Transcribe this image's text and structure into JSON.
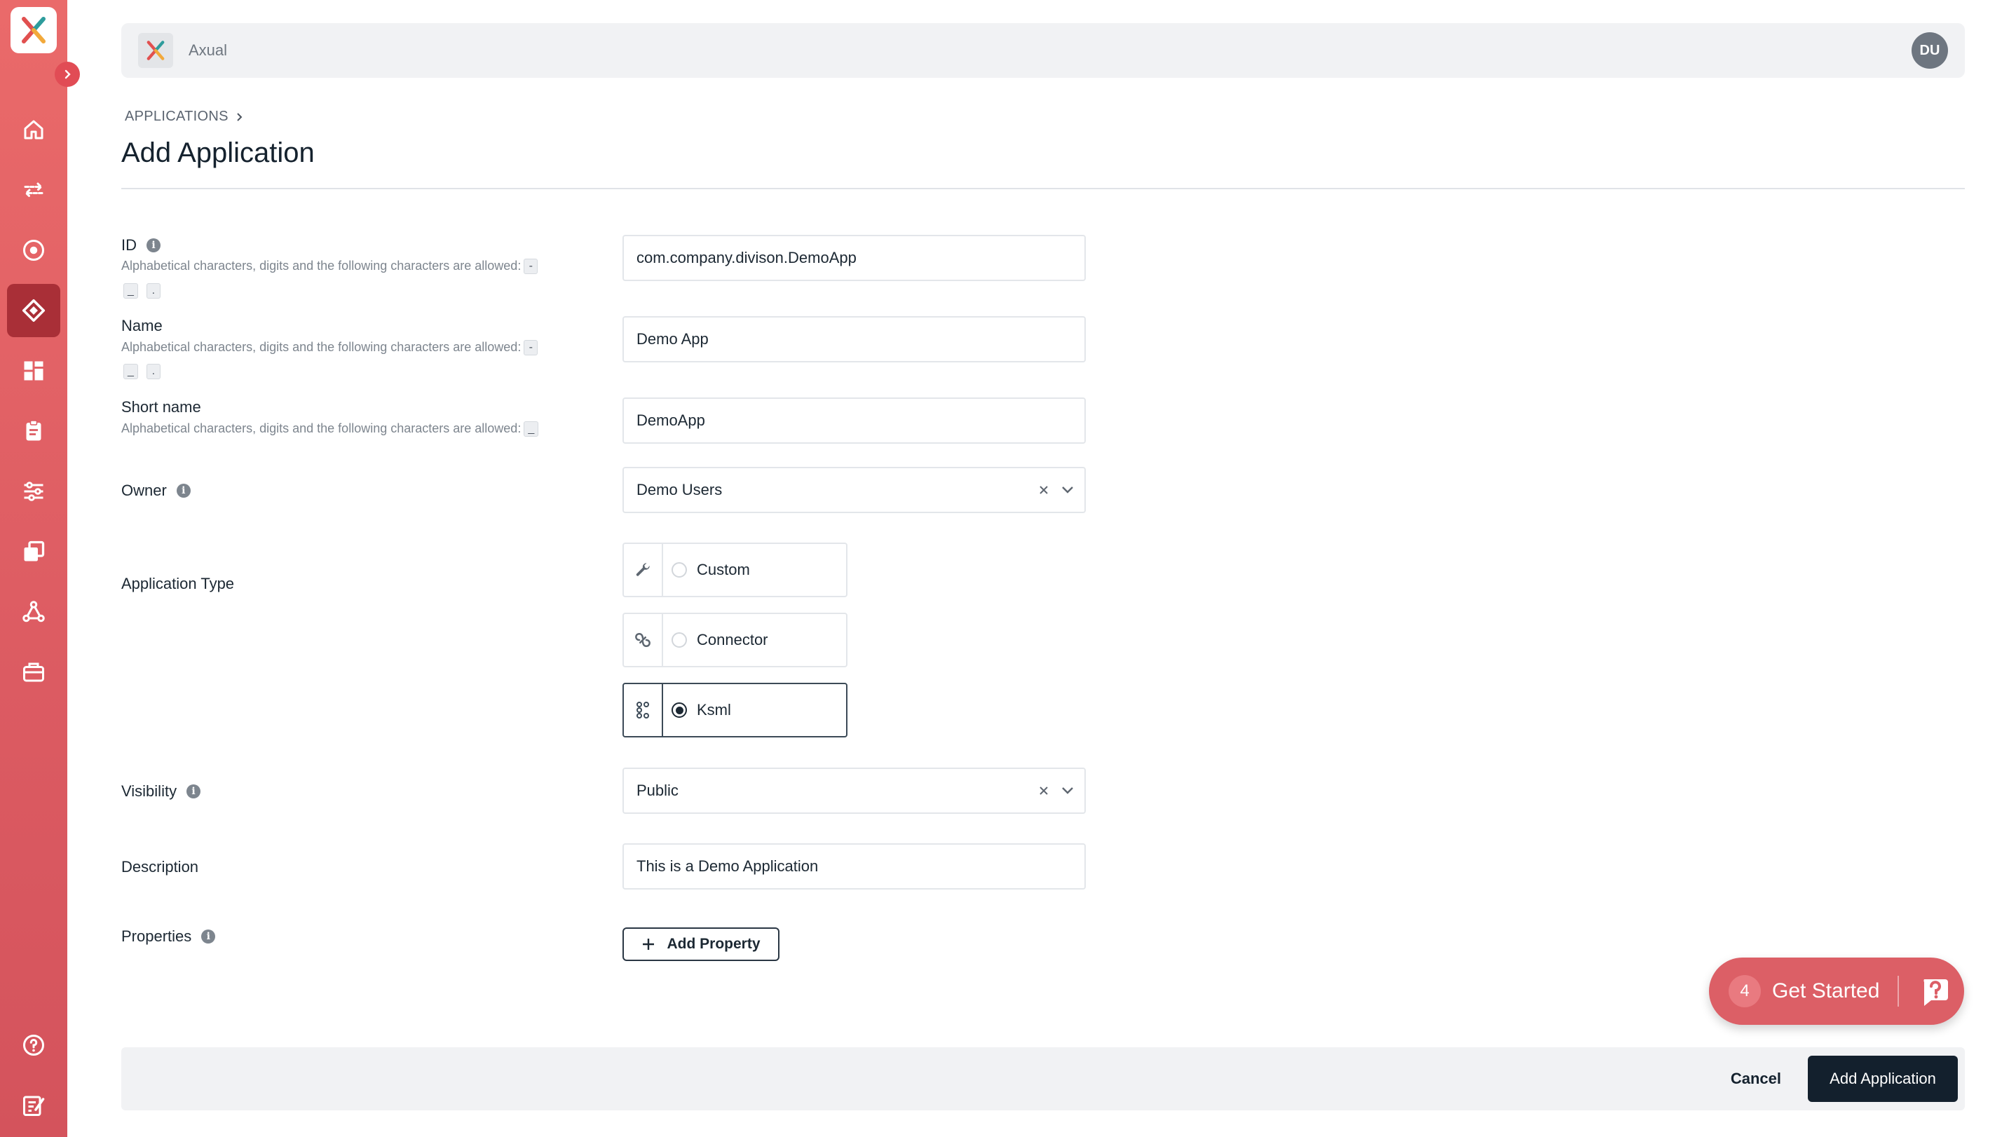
{
  "app": {
    "name": "Axual",
    "user_initials": "DU"
  },
  "colors": {
    "sidebar": "#dc5b62",
    "sidebar_active": "#a92f37",
    "primary": "#13202d",
    "get_started": "#dc5f66"
  },
  "sidebar": {
    "items": [
      {
        "icon": "home-icon"
      },
      {
        "icon": "streams-icon"
      },
      {
        "icon": "environments-icon"
      },
      {
        "icon": "applications-icon",
        "active": true
      },
      {
        "icon": "dashboard-icon"
      },
      {
        "icon": "clipboard-icon"
      },
      {
        "icon": "settings-sliders-icon"
      },
      {
        "icon": "copy-icon"
      },
      {
        "icon": "network-icon"
      },
      {
        "icon": "toolbox-icon"
      }
    ],
    "bottom": [
      {
        "icon": "help-icon"
      },
      {
        "icon": "feedback-icon"
      }
    ]
  },
  "breadcrumb": {
    "label": "APPLICATIONS"
  },
  "page": {
    "title": "Add Application"
  },
  "form": {
    "id": {
      "label": "ID",
      "help": "Alphabetical characters, digits and the following characters are allowed:",
      "chips": [
        "-",
        "_",
        "."
      ],
      "value": "com.company.divison.DemoApp"
    },
    "name": {
      "label": "Name",
      "help": "Alphabetical characters, digits and the following characters are allowed:",
      "chips": [
        "-",
        "_",
        "."
      ],
      "value": "Demo App"
    },
    "short_name": {
      "label": "Short name",
      "help": "Alphabetical characters, digits and the following characters are allowed:",
      "chips": [
        "_"
      ],
      "value": "DemoApp"
    },
    "owner": {
      "label": "Owner",
      "value": "Demo Users"
    },
    "application_type": {
      "label": "Application Type",
      "options": [
        {
          "label": "Custom",
          "icon": "wrench-icon",
          "selected": false
        },
        {
          "label": "Connector",
          "icon": "connector-icon",
          "selected": false
        },
        {
          "label": "Ksml",
          "icon": "ksml-icon",
          "selected": true
        }
      ]
    },
    "visibility": {
      "label": "Visibility",
      "value": "Public"
    },
    "description": {
      "label": "Description",
      "value": "This is a Demo Application"
    },
    "properties": {
      "label": "Properties",
      "add_label": "Add Property"
    }
  },
  "get_started": {
    "count": "4",
    "label": "Get Started"
  },
  "footer": {
    "cancel_label": "Cancel",
    "submit_label": "Add Application"
  }
}
